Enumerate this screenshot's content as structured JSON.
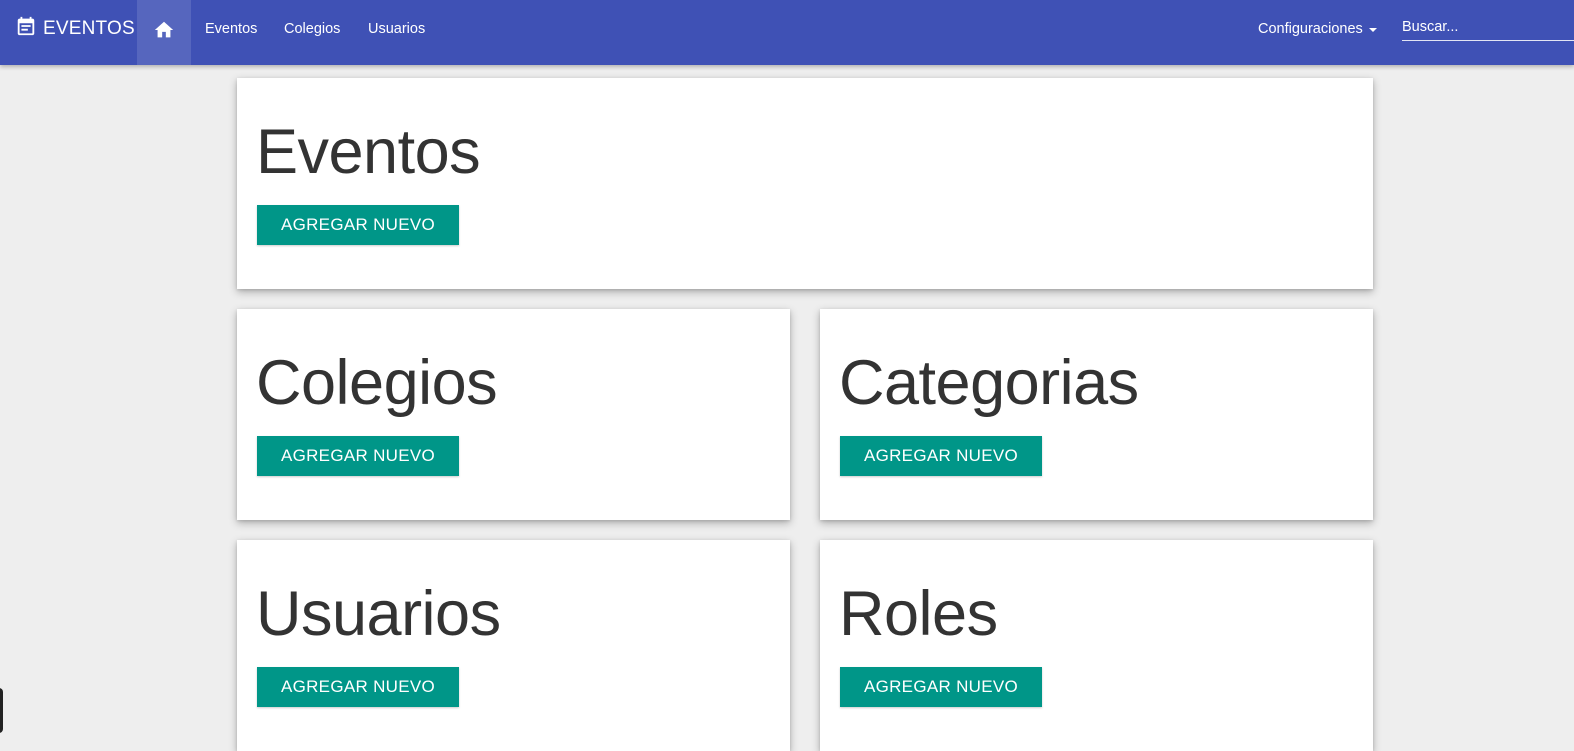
{
  "navbar": {
    "brand_label": "EVENTOS",
    "brand_icon": "calendar-icon",
    "home_icon": "home-icon",
    "links": [
      "Eventos",
      "Colegios",
      "Usuarios"
    ],
    "config_label": "Configuraciones",
    "search_placeholder": "Buscar..."
  },
  "cards": [
    {
      "title": "Eventos",
      "button_label": "AGREGAR NUEVO"
    },
    {
      "title": "Colegios",
      "button_label": "AGREGAR NUEVO"
    },
    {
      "title": "Categorias",
      "button_label": "AGREGAR NUEVO"
    },
    {
      "title": "Usuarios",
      "button_label": "AGREGAR NUEVO"
    },
    {
      "title": "Roles",
      "button_label": "AGREGAR NUEVO"
    }
  ],
  "colors": {
    "navbar": "#3f51b5",
    "button": "#009688",
    "background": "#eeeeee"
  }
}
